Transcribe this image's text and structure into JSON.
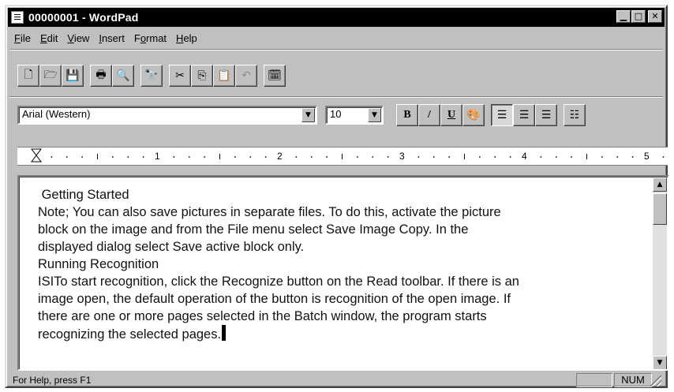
{
  "window": {
    "title": "00000001 - WordPad",
    "minimize_glyph": "▁",
    "maximize_glyph": "□",
    "close_glyph": "✕"
  },
  "menu": [
    {
      "label": "File",
      "key": "F",
      "rest": "ile"
    },
    {
      "label": "Edit",
      "key": "E",
      "rest": "dit"
    },
    {
      "label": "View",
      "key": "V",
      "rest": "iew"
    },
    {
      "label": "Insert",
      "key": "I",
      "rest": "nsert"
    },
    {
      "label": "Format",
      "pre": "F",
      "key": "o",
      "rest": "rmat"
    },
    {
      "label": "Help",
      "key": "H",
      "rest": "elp"
    }
  ],
  "toolbar": {
    "new_icon": "🗋",
    "open_icon": "🗁",
    "save_icon": "💾",
    "print_icon": "🖶",
    "preview_icon": "🔍",
    "find_icon": "🔭",
    "cut_icon": "✂",
    "copy_icon": "⎘",
    "paste_icon": "📋",
    "undo_icon": "↶",
    "datetime_icon": "🗓"
  },
  "format_bar": {
    "font": "Arial (Western)",
    "size": "10",
    "bold": "B",
    "italic": "/",
    "underline": "U",
    "color_icon": "🎨",
    "align_left_icon": "☰",
    "align_center_icon": "☰",
    "align_right_icon": "☰",
    "bullets_icon": "☷"
  },
  "ruler": {
    "numbers": [
      "1",
      "2",
      "3",
      "4",
      "5"
    ]
  },
  "document": {
    "lines": [
      " Getting Started",
      "Note; You can also save pictures in separate files. To do this, activate the picture",
      "block on the image and from the File menu select Save Image Copy. In the",
      "displayed dialog select Save active block only.",
      "Running Recognition",
      "ISITo start recognition, click the Recognize button on the Read toolbar. If there is an",
      "image open, the default operation of the button is recognition of the open image. If",
      "there are one or more pages selected in the Batch window, the program starts",
      "recognizing the selected pages."
    ]
  },
  "status": {
    "help_text": "For Help, press F1",
    "num": "NUM"
  },
  "colors": {
    "face": "#c0c0c0",
    "title_bg": "#000000",
    "title_fg": "#ffffff"
  }
}
